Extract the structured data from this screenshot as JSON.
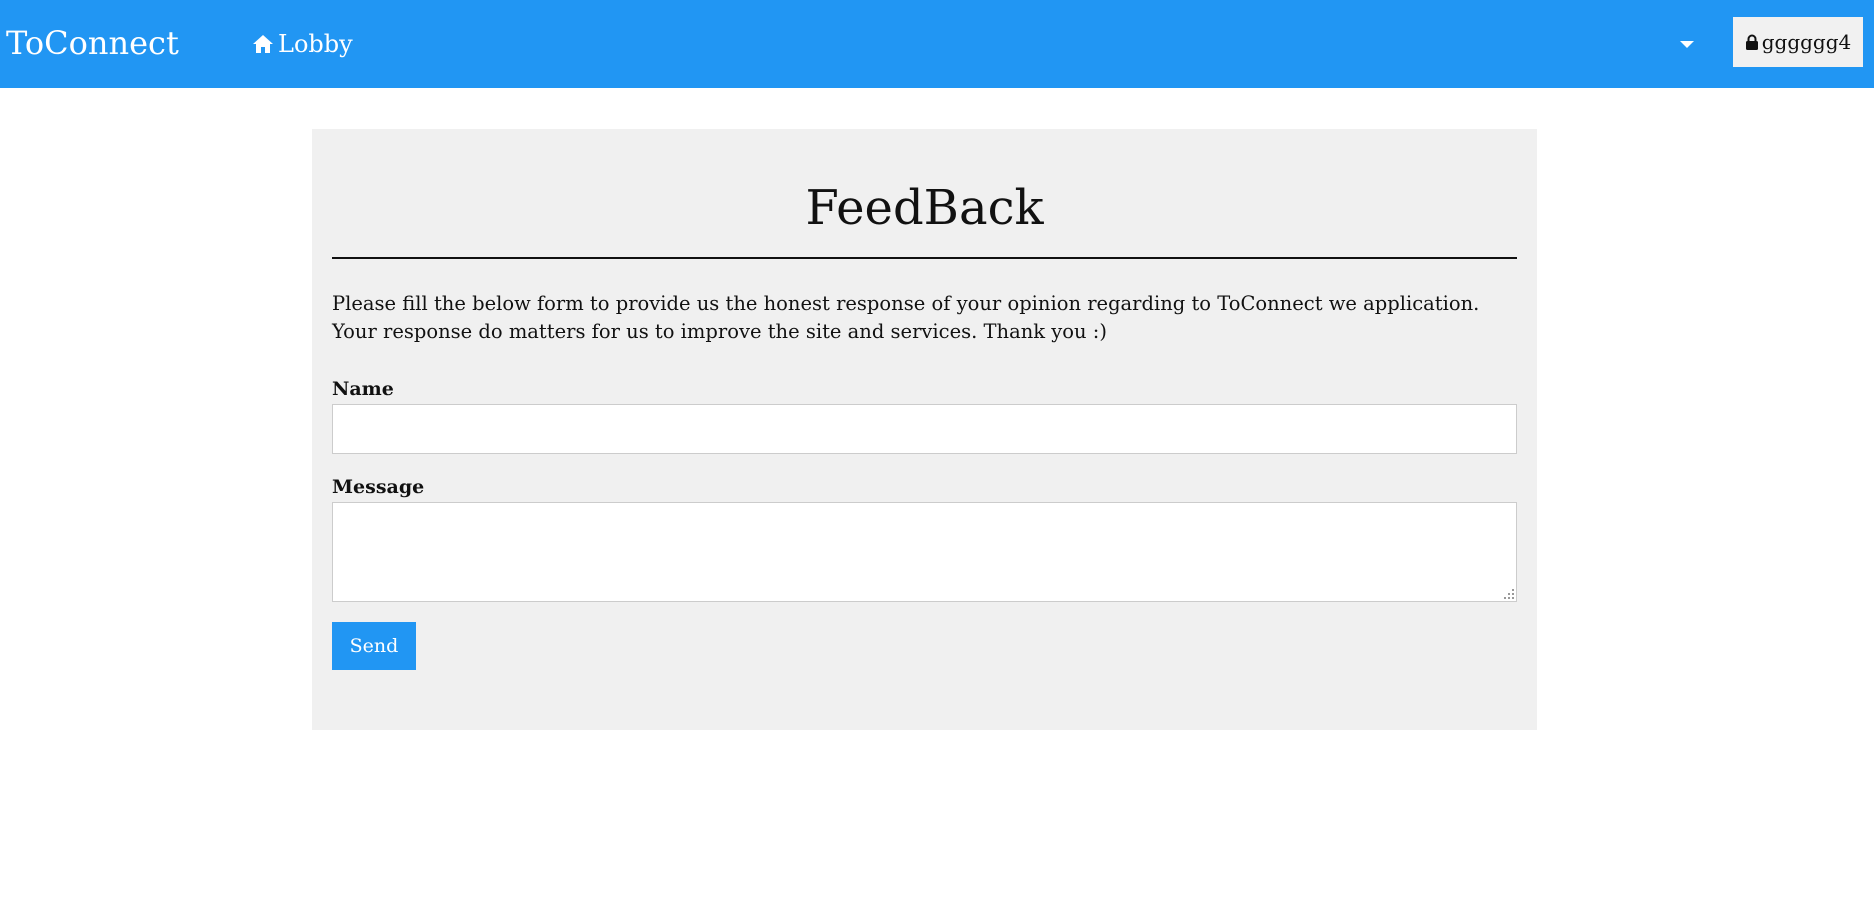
{
  "header": {
    "brand": "ToConnect",
    "nav": {
      "lobby_label": "Lobby",
      "lobby_icon": "home-icon"
    },
    "dropdown_icon": "caret-down-icon",
    "user": {
      "label": "gggggg4",
      "icon": "lock-icon"
    }
  },
  "feedback": {
    "title": "FeedBack",
    "intro": "Please fill the below form to provide us the honest response of your opinion regarding to ToConnect we application. Your response do matters for us to improve the site and services. Thank you :)",
    "name_label": "Name",
    "name_value": "",
    "message_label": "Message",
    "message_value": "",
    "send_label": "Send"
  },
  "colors": {
    "primary": "#2196f3",
    "card_background": "#f0f0f0",
    "user_button_background": "#f1f1f1"
  }
}
